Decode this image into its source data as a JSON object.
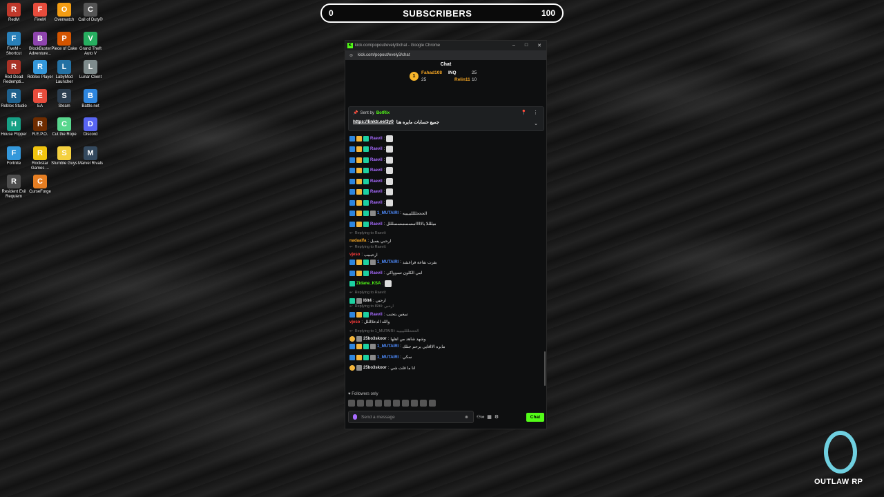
{
  "desktop": {
    "icons": [
      {
        "label": "RedM",
        "color": "#c0392b",
        "glyph": "R"
      },
      {
        "label": "FiveM",
        "color": "#e74c3c",
        "glyph": "F"
      },
      {
        "label": "Overwatch",
        "color": "#f39c12",
        "glyph": "O"
      },
      {
        "label": "Call of Duty®",
        "color": "#555555",
        "glyph": "C"
      },
      {
        "label": "FiveM - Shortcut",
        "color": "#2980b9",
        "glyph": "F"
      },
      {
        "label": "BlockBuster Adventure...",
        "color": "#8e44ad",
        "glyph": "B"
      },
      {
        "label": "Piece of Cake",
        "color": "#d35400",
        "glyph": "P"
      },
      {
        "label": "Grand Theft Auto V",
        "color": "#27ae60",
        "glyph": "V"
      },
      {
        "label": "Red Dead Redempti...",
        "color": "#a93226",
        "glyph": "R"
      },
      {
        "label": "Roblox Player",
        "color": "#3498db",
        "glyph": "R"
      },
      {
        "label": "LabyMod Launcher",
        "color": "#2471a3",
        "glyph": "L"
      },
      {
        "label": "Lunar Client",
        "color": "#7f8c8d",
        "glyph": "L"
      },
      {
        "label": "Roblox Studio",
        "color": "#1f618d",
        "glyph": "R"
      },
      {
        "label": "EA",
        "color": "#e74c3c",
        "glyph": "E"
      },
      {
        "label": "Steam",
        "color": "#2c3e50",
        "glyph": "S"
      },
      {
        "label": "Battle.net",
        "color": "#2e86de",
        "glyph": "B"
      },
      {
        "label": "House Flipper",
        "color": "#16a085",
        "glyph": "H"
      },
      {
        "label": "R.E.P.O.",
        "color": "#6e2c00",
        "glyph": "R"
      },
      {
        "label": "Cut the Rope",
        "color": "#58d68d",
        "glyph": "C"
      },
      {
        "label": "Discord",
        "color": "#5865f2",
        "glyph": "D"
      },
      {
        "label": "Fortnite",
        "color": "#3498db",
        "glyph": "F"
      },
      {
        "label": "Rockstar Games ...",
        "color": "#f1c40f",
        "glyph": "R"
      },
      {
        "label": "Stumble Guys",
        "color": "#f4d03f",
        "glyph": "S"
      },
      {
        "label": "Marvel Rivals",
        "color": "#34495e",
        "glyph": "M"
      },
      {
        "label": "Resident Evil Requiem",
        "color": "#4d4d4d",
        "glyph": "R"
      },
      {
        "label": "CurseForge",
        "color": "#e67e22",
        "glyph": "C"
      }
    ]
  },
  "subscribers": {
    "min": "0",
    "label": "SUBSCRIBERS",
    "max": "100"
  },
  "browser": {
    "title": "kick.com/popout/evely3/chat - Google Chrome",
    "url": "kick.com/popout/evely3/chat"
  },
  "chat": {
    "header": "Chat",
    "top_gifters": {
      "first": {
        "name": "Fahad108",
        "count": "25"
      },
      "second": {
        "name": "INQ",
        "count": "25"
      },
      "third": {
        "name": "Relin11",
        "count": "10"
      }
    },
    "pinned": {
      "sent_by": "Sent by",
      "sender": "BotRix",
      "text": "جميع حسابات مايره هنا",
      "link": "https://linktr.ee/3y0"
    },
    "messages": [
      {
        "user": "Raevil",
        "text": ""
      },
      {
        "user": "Raevil",
        "text": ""
      },
      {
        "user": "Raevil",
        "text": ""
      },
      {
        "user": "Raevil",
        "text": ""
      },
      {
        "user": "Raevil",
        "text": ""
      },
      {
        "user": "Raevil",
        "text": ""
      },
      {
        "user": "Raevil",
        "text": ""
      },
      {
        "user": "1_MUTAIRI",
        "text": "الحححلللليييييه"
      },
      {
        "user": "Raevil",
        "text": "ميللللا يالاااااسسسسسسلللل"
      },
      {
        "reply": "Replying to Raevil:",
        "user": "nadaalfa",
        "text": "ارحبي يسيل"
      },
      {
        "reply": "Replying to Raevil:",
        "user": "vjeso",
        "text": "ارحبببب"
      },
      {
        "user": "1_MUTAIRI",
        "text": "بقرت نفاعة فراغشد"
      },
      {
        "user": "Raevil",
        "text": "امي الكلون تسوواكي"
      },
      {
        "user": "Zidane_KSA",
        "text": ""
      },
      {
        "reply": "Replying to Raevil:",
        "user": "I6lt4",
        "text": "ارحبي"
      },
      {
        "reply": "Replying to I6lt4: ارحبي",
        "user": "Raevil",
        "text": "تبيغين يتحبب"
      },
      {
        "user": "vjeso",
        "text": "والله الدعلالللل"
      },
      {
        "reply": "Replying to 1_MUTAIRI: الحححلللليييييه",
        "user": "25bo3skoor",
        "text": "وشهد شاهد من اهلها"
      },
      {
        "user": "1_MUTAIRI",
        "text": "مايره الااقايي يرحم جنلك"
      },
      {
        "user": "1_MUTAIRI",
        "text": "سكي"
      },
      {
        "user": "25bo3skoor",
        "text": "انا ما قلت شي"
      }
    ],
    "followers_only": "Followers only",
    "input_placeholder": "Send a message",
    "send_label": "Chat"
  },
  "logo": {
    "text": "OUTLAW RP"
  }
}
